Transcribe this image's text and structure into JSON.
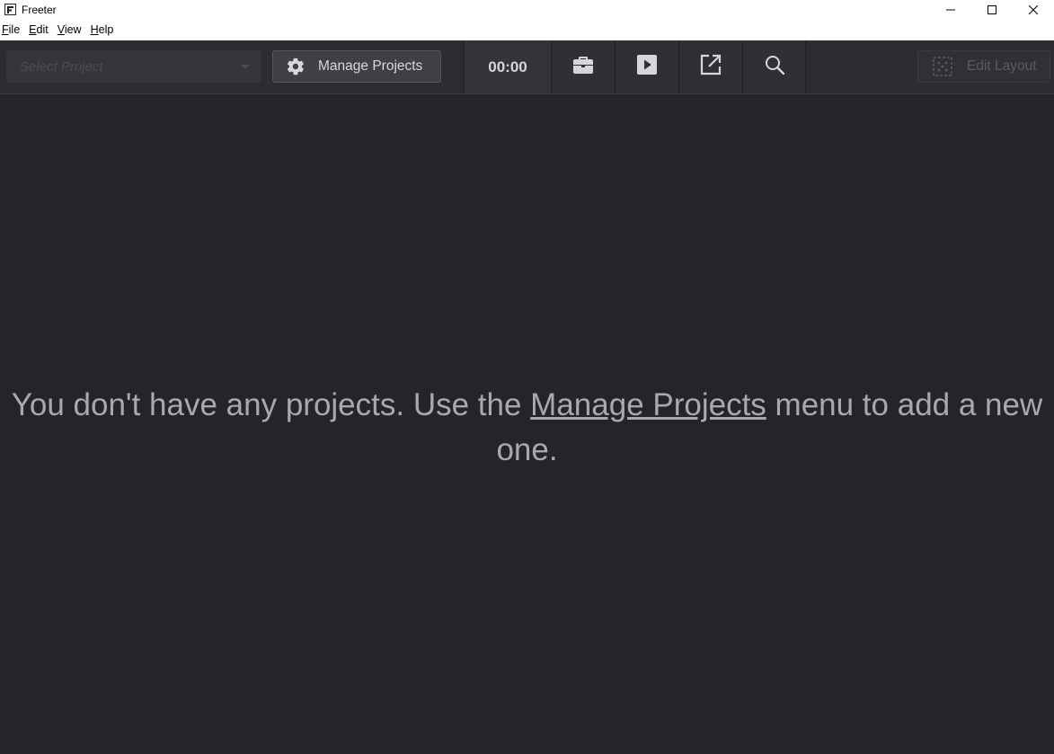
{
  "window": {
    "title": "Freeter",
    "controls": [
      "minimize-icon",
      "maximize-icon",
      "close-icon"
    ]
  },
  "menubar": {
    "items": [
      {
        "label": "File",
        "mnemonic": "F",
        "rest": "ile"
      },
      {
        "label": "Edit",
        "mnemonic": "E",
        "rest": "dit"
      },
      {
        "label": "View",
        "mnemonic": "V",
        "rest": "iew"
      },
      {
        "label": "Help",
        "mnemonic": "H",
        "rest": "elp"
      }
    ]
  },
  "toolbar": {
    "project_select": {
      "placeholder": "Select Project"
    },
    "manage_projects_label": "Manage Projects",
    "timer": "00:00",
    "tools": [
      "briefcase-icon",
      "play-icon",
      "external-link-icon",
      "search-icon"
    ],
    "edit_layout_label": "Edit Layout"
  },
  "main": {
    "message_before": "You don't have any projects. Use the ",
    "message_link": "Manage Projects",
    "message_after": " menu to add a new one."
  },
  "colors": {
    "background": "#242529",
    "toolbar": "#2c2d31",
    "text_muted": "#a8a9ae"
  }
}
